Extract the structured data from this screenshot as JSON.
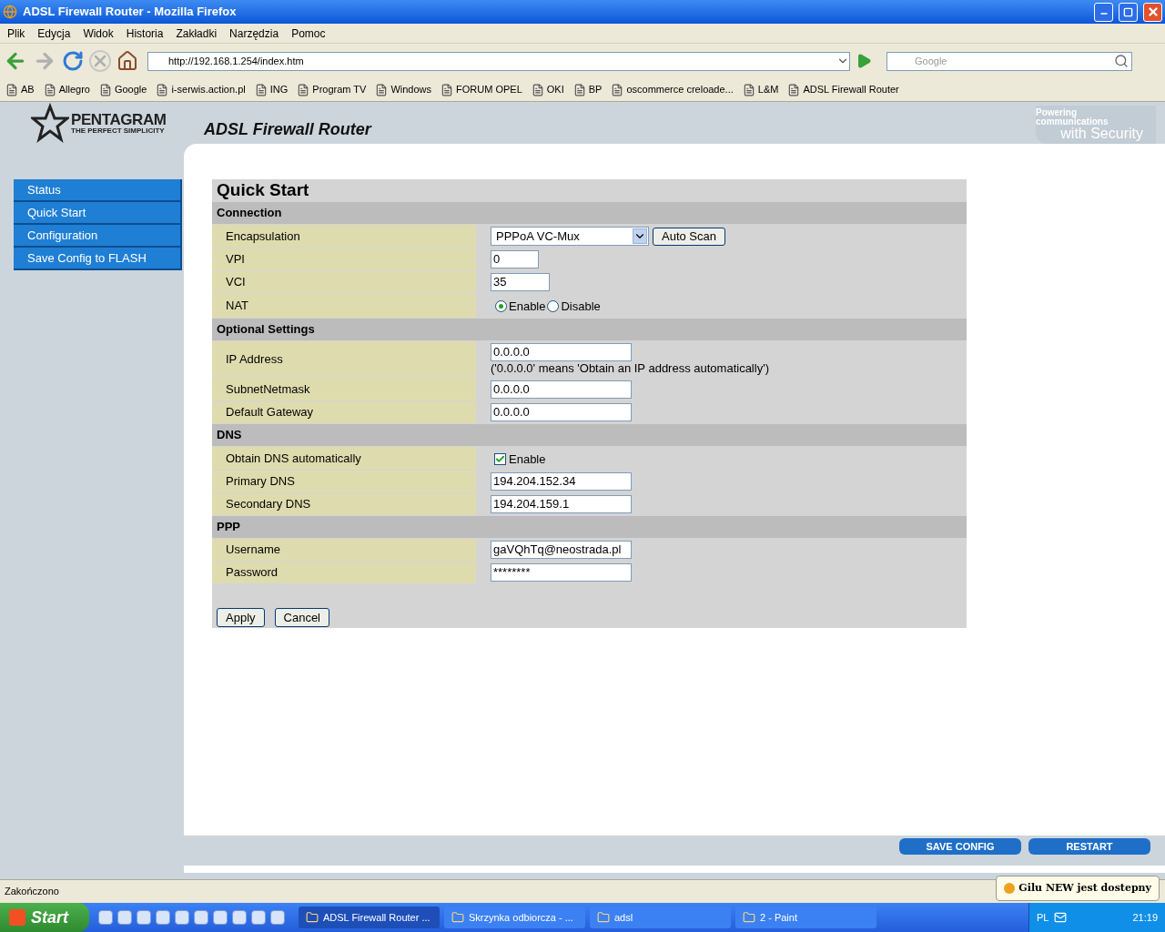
{
  "window": {
    "title": "ADSL Firewall Router - Mozilla Firefox"
  },
  "menu": [
    "Plik",
    "Edycja",
    "Widok",
    "Historia",
    "Zakładki",
    "Narzędzia",
    "Pomoc"
  ],
  "toolbar": {
    "url": "http://192.168.1.254/index.htm",
    "search_placeholder": "Google"
  },
  "bookmarks": [
    {
      "label": "AB"
    },
    {
      "label": "Allegro"
    },
    {
      "label": "Google"
    },
    {
      "label": "i-serwis.action.pl"
    },
    {
      "label": "ING"
    },
    {
      "label": "Program TV"
    },
    {
      "label": "Windows"
    },
    {
      "label": "FORUM OPEL"
    },
    {
      "label": "OKI"
    },
    {
      "label": "BP"
    },
    {
      "label": "oscommerce creloade..."
    },
    {
      "label": "L&M"
    },
    {
      "label": "ADSL Firewall Router"
    }
  ],
  "header": {
    "brand": "PENTAGRAM",
    "tagline": "THE PERFECT SIMPLICITY",
    "title": "ADSL Firewall Router",
    "slogan_top": "Powering communications",
    "slogan_bottom": "with Security"
  },
  "sidebar": {
    "items": [
      "Status",
      "Quick Start",
      "Configuration",
      "Save Config to FLASH"
    ]
  },
  "form": {
    "title": "Quick Start",
    "sections": [
      {
        "title": "Connection",
        "rows": [
          {
            "label": "Encapsulation",
            "kind": "select",
            "value": "PPPoA VC-Mux",
            "button": "Auto Scan"
          },
          {
            "label": "VPI",
            "kind": "short",
            "value": "0"
          },
          {
            "label": "VCI",
            "kind": "short",
            "value": "35"
          },
          {
            "label": "NAT",
            "kind": "radio",
            "options": [
              {
                "label": "Enable",
                "selected": true
              },
              {
                "label": "Disable",
                "selected": false
              }
            ]
          }
        ]
      },
      {
        "title": "Optional Settings",
        "rows": [
          {
            "label": "IP Address",
            "kind": "text",
            "value": "0.0.0.0",
            "note": "('0.0.0.0' means 'Obtain an IP address automatically')"
          },
          {
            "label": "SubnetNetmask",
            "kind": "text",
            "value": "0.0.0.0"
          },
          {
            "label": "Default Gateway",
            "kind": "text",
            "value": "0.0.0.0"
          }
        ]
      },
      {
        "title": "DNS",
        "rows": [
          {
            "label": "Obtain DNS automatically",
            "kind": "checkbox",
            "checked": true,
            "option": "Enable"
          },
          {
            "label": "Primary DNS",
            "kind": "text",
            "value": "194.204.152.34"
          },
          {
            "label": "Secondary DNS",
            "kind": "text",
            "value": "194.204.159.1"
          }
        ]
      },
      {
        "title": "PPP",
        "rows": [
          {
            "label": "Username",
            "kind": "text",
            "value": "gaVQhTq@neostrada.pl"
          },
          {
            "label": "Password",
            "kind": "text",
            "value": "********"
          }
        ]
      }
    ],
    "buttons": [
      "Apply",
      "Cancel"
    ]
  },
  "page_buttons": [
    "SAVE CONFIG",
    "RESTART"
  ],
  "status_bar": {
    "text": "Zakończono"
  },
  "notification": {
    "text": "Gilu NEW jest dostepny"
  },
  "taskbar": {
    "start": "Start",
    "tasks": [
      {
        "label": "ADSL Firewall Router ...",
        "selected": true
      },
      {
        "label": "Skrzynka odbiorcza - ...",
        "selected": false
      },
      {
        "label": "adsl",
        "selected": false
      },
      {
        "label": "2 - Paint",
        "selected": false
      }
    ],
    "language": "PL",
    "clock": "21:19"
  }
}
